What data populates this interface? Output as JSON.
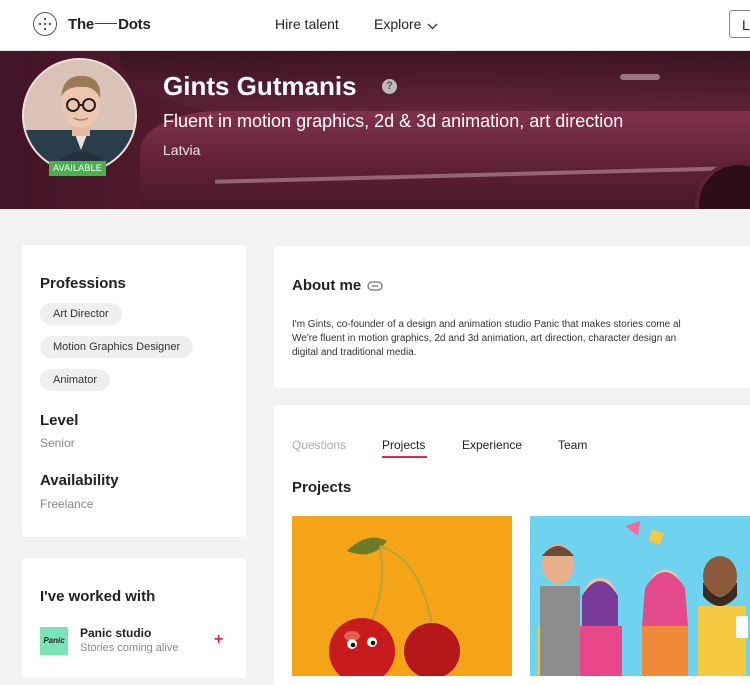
{
  "nav": {
    "logo_left": "The",
    "logo_right": "Dots",
    "hire_talent": "Hire talent",
    "explore": "Explore",
    "login_label": "L"
  },
  "profile": {
    "name": "Gints Gutmanis",
    "tagline": "Fluent in motion graphics, 2d & 3d animation, art direction",
    "location": "Latvia",
    "availability_badge": "AVAILABLE",
    "help_icon": "?"
  },
  "professions_card": {
    "title": "Professions",
    "chips": [
      "Art Director",
      "Motion Graphics Designer",
      "Animator"
    ],
    "level_title": "Level",
    "level_value": "Senior",
    "availability_title": "Availability",
    "availability_value": "Freelance"
  },
  "worked_with": {
    "title": "I've worked with",
    "items": [
      {
        "logo_text": "Panic",
        "name": "Panic studio",
        "subtitle": "Stories coming alive",
        "action": "+"
      }
    ]
  },
  "about": {
    "title": "About me",
    "lines": [
      "I'm Gints, co-founder of a design and animation studio Panic that makes stories come al",
      "We're fluent in motion graphics, 2d and 3d animation, art direction, character design an",
      "digital and traditional media."
    ]
  },
  "tabs": [
    "Questions",
    "Projects",
    "Experience",
    "Team"
  ],
  "active_tab": "Projects",
  "projects": {
    "heading": "Projects"
  },
  "colors": {
    "accent": "#e0284f",
    "available_green": "#4cae4f",
    "cherry_bg": "#f5a317",
    "people_bg": "#6fd2ee"
  }
}
